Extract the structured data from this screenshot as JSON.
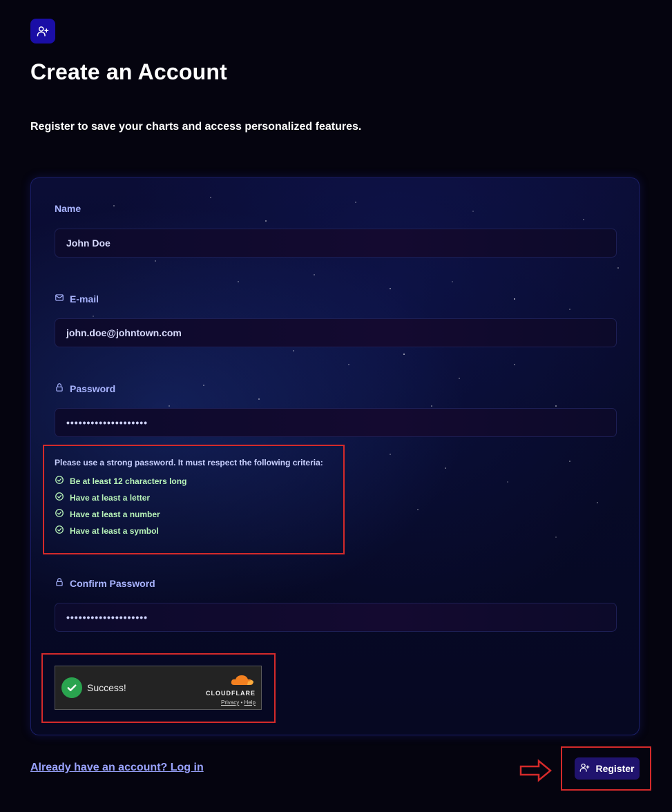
{
  "header": {
    "icon": "user-plus-icon",
    "title": "Create an Account",
    "subtitle": "Register to save your charts and access personalized features."
  },
  "form": {
    "name": {
      "label": "Name",
      "value": "John Doe"
    },
    "email": {
      "label": "E-mail",
      "icon": "mail-icon",
      "value": "john.doe@johntown.com"
    },
    "password": {
      "label": "Password",
      "icon": "lock-icon",
      "value": "••••••••••••••••••••"
    },
    "criteria": {
      "title": "Please use a strong password. It must respect the following criteria:",
      "items": [
        "Be at least 12 characters long",
        "Have at least a letter",
        "Have at least a number",
        "Have at least a symbol"
      ],
      "met_color": "#b9f5b9"
    },
    "confirm_password": {
      "label": "Confirm Password",
      "icon": "lock-icon",
      "value": "••••••••••••••••••••"
    },
    "captcha": {
      "status": "Success!",
      "brand": "CLOUDFLARE",
      "privacy": "Privacy",
      "separator": "•",
      "help": "Help"
    }
  },
  "footer": {
    "login_link": "Already have an account? Log in",
    "register_button": "Register"
  },
  "colors": {
    "background": "#05040f",
    "accent": "#20136e",
    "label": "#a9b4ff",
    "annotation": "#d42a2a",
    "success": "#2aa44f",
    "cloudflare": "#f38020"
  }
}
